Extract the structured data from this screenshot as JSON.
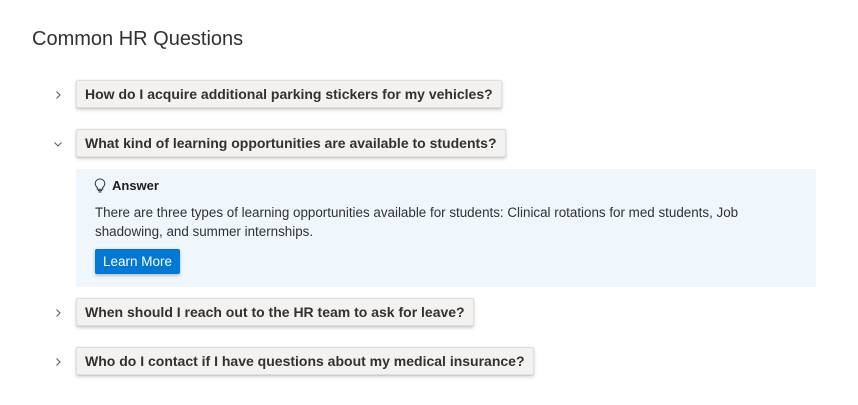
{
  "page": {
    "title": "Common HR Questions"
  },
  "faq": {
    "items": [
      {
        "question": "How do I acquire additional parking stickers for my vehicles?",
        "expanded": false
      },
      {
        "question": "What kind of learning opportunities are available to students?",
        "expanded": true,
        "answer_title": "Answer",
        "answer_text": "There are three types of learning opportunities available for students: Clinical rotations for med students, Job shadowing, and summer internships.",
        "button_label": "Learn More"
      },
      {
        "question": "When should I reach out to the HR team to ask for leave?",
        "expanded": false
      },
      {
        "question": "Who do I contact if I have questions about my medical insurance?",
        "expanded": false
      }
    ]
  },
  "icons": {
    "collapsed": "chevron-right-icon",
    "expanded": "chevron-down-icon",
    "answer": "lightbulb-icon"
  },
  "colors": {
    "accent": "#0078d4",
    "answer_background": "#eff6fc",
    "question_background": "#f3f2f1"
  }
}
